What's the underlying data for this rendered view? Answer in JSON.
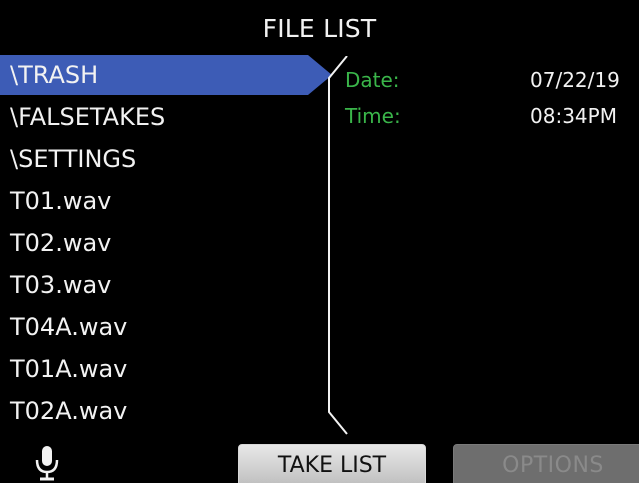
{
  "header": {
    "title": "FILE LIST"
  },
  "file_list": {
    "items": [
      {
        "label": "\\TRASH",
        "selected": true
      },
      {
        "label": "\\FALSETAKES",
        "selected": false
      },
      {
        "label": "\\SETTINGS",
        "selected": false
      },
      {
        "label": "T01.wav",
        "selected": false
      },
      {
        "label": "T02.wav",
        "selected": false
      },
      {
        "label": "T03.wav",
        "selected": false
      },
      {
        "label": "T04A.wav",
        "selected": false
      },
      {
        "label": "T01A.wav",
        "selected": false
      },
      {
        "label": "T02A.wav",
        "selected": false
      }
    ]
  },
  "info": {
    "date_label": "Date:",
    "date_value": "07/22/19",
    "time_label": "Time:",
    "time_value": "08:34PM"
  },
  "footer": {
    "mic_icon": "microphone-icon",
    "take_list_label": "TAKE LIST",
    "options_label": "OPTIONS"
  },
  "colors": {
    "selection": "#3d5cb6",
    "label_green": "#3ab54a",
    "background": "#000000",
    "text": "#f2f2f2"
  }
}
